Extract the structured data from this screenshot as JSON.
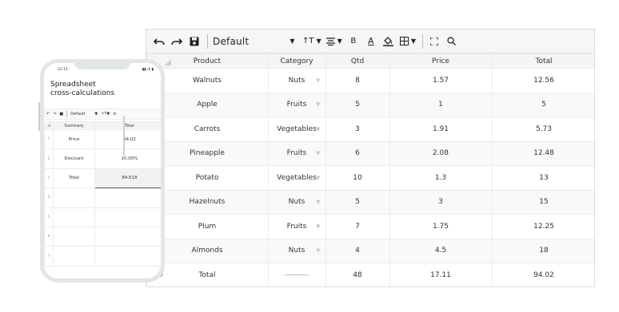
{
  "sheet": {
    "toolbar": {
      "undo_icon": "undo-icon",
      "redo_icon": "redo-icon",
      "save_icon": "save-icon",
      "font_name": "Default",
      "font_size_label": "↑T",
      "align_icon": "align-icon",
      "bold_label": "B",
      "text_color_label": "A",
      "fill_icon": "fill-color-icon",
      "borders_icon": "borders-icon",
      "fullscreen_icon": "fullscreen-icon",
      "search_icon": "search-icon"
    },
    "columns": [
      "Product",
      "Category",
      "Qtd",
      "Price",
      "Total"
    ],
    "rows": [
      {
        "product": "Walnuts",
        "category": "Nuts",
        "qty": "8",
        "price": "1.57",
        "total": "12.56"
      },
      {
        "product": "Apple",
        "category": "Fruits",
        "qty": "5",
        "price": "1",
        "total": "5"
      },
      {
        "product": "Carrots",
        "category": "Vegetables",
        "qty": "3",
        "price": "1.91",
        "total": "5.73"
      },
      {
        "product": "Pineapple",
        "category": "Fruits",
        "qty": "6",
        "price": "2.08",
        "total": "12.48"
      },
      {
        "product": "Potato",
        "category": "Vegetables",
        "qty": "10",
        "price": "1.3",
        "total": "13"
      },
      {
        "product": "Hazelnuts",
        "category": "Nuts",
        "qty": "5",
        "price": "3",
        "total": "15"
      },
      {
        "product": "Plum",
        "category": "Fruits",
        "qty": "7",
        "price": "1.75",
        "total": "12.25"
      },
      {
        "product": "Almonds",
        "category": "Nuts",
        "qty": "4",
        "price": "4.5",
        "total": "18"
      }
    ],
    "total_row": {
      "label": "Total",
      "qty": "48",
      "price": "17.11",
      "total": "94.02",
      "row_number": "9"
    }
  },
  "phone": {
    "time": "22:11",
    "status_icons": "▮▮ ◔ ▮",
    "title_line1": "Spreadsheet",
    "title_line2": "cross-calculations",
    "font_name": "Default",
    "columns": [
      "Summary",
      "Total"
    ],
    "rows": [
      {
        "num": "1",
        "label": "Price",
        "value": "94.02"
      },
      {
        "num": "2",
        "label": "Discount",
        "value": "10.00%"
      },
      {
        "num": "3",
        "label": "Total",
        "value": "84.618"
      },
      {
        "num": "4",
        "label": "",
        "value": ""
      },
      {
        "num": "5",
        "label": "",
        "value": ""
      },
      {
        "num": "6",
        "label": "",
        "value": ""
      },
      {
        "num": "7",
        "label": "",
        "value": ""
      }
    ]
  }
}
